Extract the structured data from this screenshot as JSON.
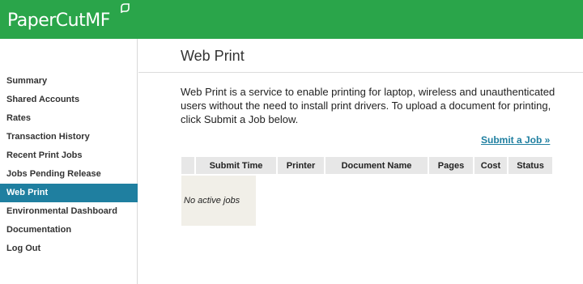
{
  "header": {
    "logo_text": "PaperCutMF",
    "brand_color": "#2aa54a"
  },
  "sidebar": {
    "active_color": "#1f7fa0",
    "items": [
      {
        "label": "Summary"
      },
      {
        "label": "Shared Accounts"
      },
      {
        "label": "Rates"
      },
      {
        "label": "Transaction History"
      },
      {
        "label": "Recent Print Jobs"
      },
      {
        "label": "Jobs Pending Release"
      },
      {
        "label": "Web Print",
        "active": true
      },
      {
        "label": "Environmental Dashboard"
      },
      {
        "label": "Documentation"
      },
      {
        "label": "Log Out"
      }
    ]
  },
  "main": {
    "title": "Web Print",
    "intro": "Web Print is a service to enable printing for laptop, wireless and unauthenticated users without the need to install print drivers. To upload a document for printing, click Submit a Job below.",
    "submit_link": "Submit a Job »",
    "table": {
      "columns": [
        "",
        "Submit Time",
        "Printer",
        "Document Name",
        "Pages",
        "Cost",
        "Status"
      ],
      "empty_message": "No active jobs"
    }
  }
}
